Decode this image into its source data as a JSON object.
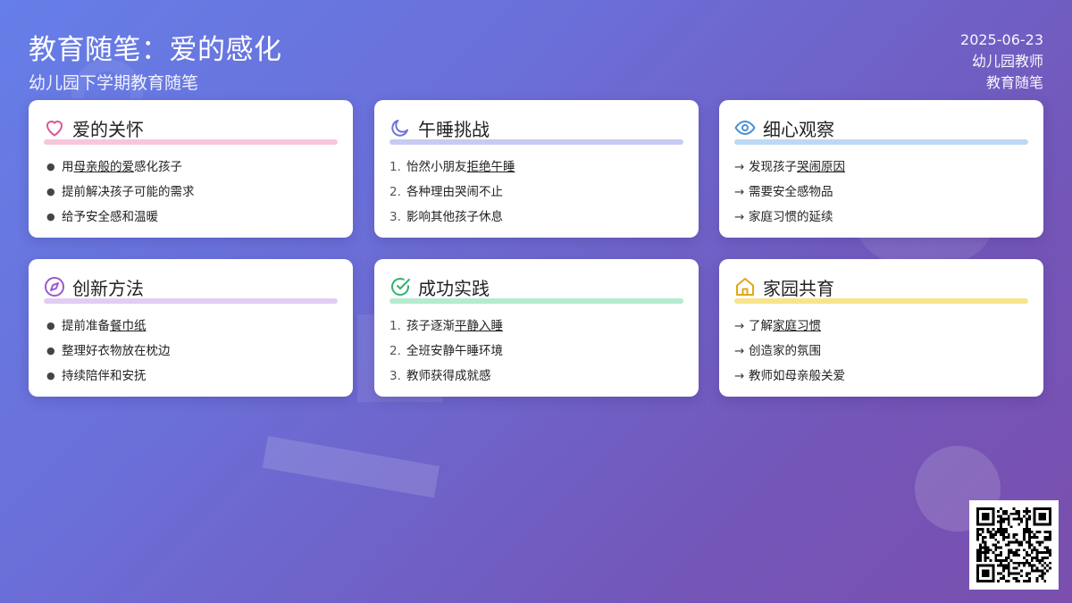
{
  "header": {
    "title": "教育随笔：爱的感化",
    "subtitle": "幼儿园下学期教育随笔",
    "date": "2025-06-23",
    "author": "幼儿园教师",
    "category": "教育随笔"
  },
  "colors": {
    "pink": "#f7c6dc",
    "indigo": "#c7cbf3",
    "blue": "#bcd9f4",
    "purple": "#e1cdf3",
    "green": "#b5ebcf",
    "yellow": "#f8e48c"
  },
  "cards": [
    {
      "title": "爱的关怀",
      "icon": "heart-icon",
      "items": [
        {
          "pre": "用",
          "u": "母亲般的爱",
          "post": "感化孩子"
        },
        {
          "pre": "提前解决孩子可能的需求",
          "u": "",
          "post": ""
        },
        {
          "pre": "给予安全感和温暖",
          "u": "",
          "post": ""
        }
      ]
    },
    {
      "title": "午睡挑战",
      "icon": "moon-icon",
      "items": [
        {
          "marker": "1.",
          "pre": "怡然小朋友",
          "u": "拒绝午睡",
          "post": ""
        },
        {
          "marker": "2.",
          "pre": "各种理由哭闹不止",
          "u": "",
          "post": ""
        },
        {
          "marker": "3.",
          "pre": "影响其他孩子休息",
          "u": "",
          "post": ""
        }
      ]
    },
    {
      "title": "细心观察",
      "icon": "eye-icon",
      "items": [
        {
          "marker": "→",
          "pre": "发现孩子",
          "u": "哭闹原因",
          "post": ""
        },
        {
          "marker": "→",
          "pre": "需要安全感物品",
          "u": "",
          "post": ""
        },
        {
          "marker": "→",
          "pre": "家庭习惯的延续",
          "u": "",
          "post": ""
        }
      ]
    },
    {
      "title": "创新方法",
      "icon": "compass-icon",
      "items": [
        {
          "pre": "提前准备",
          "u": "餐巾纸",
          "post": ""
        },
        {
          "pre": "整理好衣物放在枕边",
          "u": "",
          "post": ""
        },
        {
          "pre": "持续陪伴和安抚",
          "u": "",
          "post": ""
        }
      ]
    },
    {
      "title": "成功实践",
      "icon": "check-circle-icon",
      "items": [
        {
          "marker": "1.",
          "pre": "孩子逐渐",
          "u": "平静入睡",
          "post": ""
        },
        {
          "marker": "2.",
          "pre": "全班安静午睡环境",
          "u": "",
          "post": ""
        },
        {
          "marker": "3.",
          "pre": "教师获得成就感",
          "u": "",
          "post": ""
        }
      ]
    },
    {
      "title": "家园共育",
      "icon": "home-icon",
      "items": [
        {
          "marker": "→",
          "pre": "了解",
          "u": "家庭习惯",
          "post": ""
        },
        {
          "marker": "→",
          "pre": "创造家的氛围",
          "u": "",
          "post": ""
        },
        {
          "marker": "→",
          "pre": "教师如母亲般关爱",
          "u": "",
          "post": ""
        }
      ]
    }
  ],
  "qr": {
    "icon": "qr-code-icon"
  }
}
